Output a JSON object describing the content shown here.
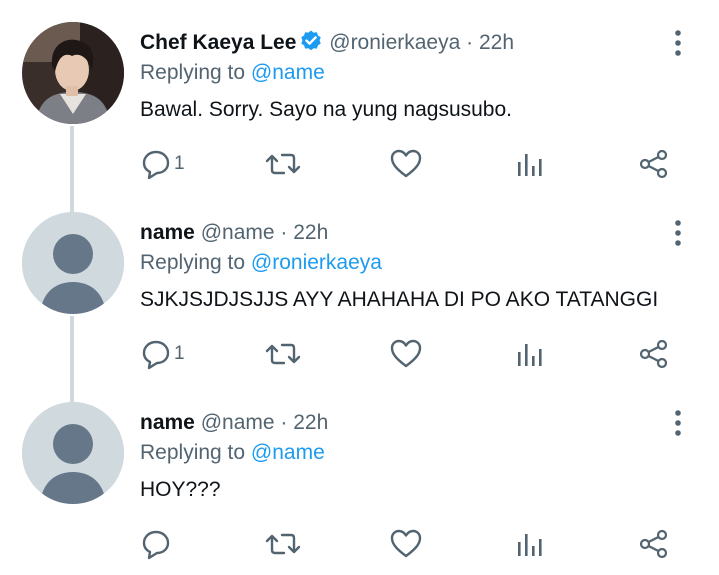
{
  "tweets": [
    {
      "display_name": "Chef Kaeya Lee",
      "verified": true,
      "handle": "@ronierkaeya",
      "separator": "·",
      "time": "22h",
      "replying_prefix": "Replying to",
      "replying_to": "@name",
      "text": "Bawal. Sorry. Sayo na yung nagsusubo.",
      "reply_count": "1",
      "avatar": "photo-avatar"
    },
    {
      "display_name": "name",
      "verified": false,
      "handle": "@name",
      "separator": "·",
      "time": "22h",
      "replying_prefix": "Replying to",
      "replying_to": "@ronierkaeya",
      "text": "SJKJSJDJSJJS AYY AHAHAHA DI PO AKO TATANGGI",
      "reply_count": "1",
      "avatar": "default-avatar"
    },
    {
      "display_name": "name",
      "verified": false,
      "handle": "@name",
      "separator": "·",
      "time": "22h",
      "replying_prefix": "Replying to",
      "replying_to": "@name",
      "text": "HOY???",
      "reply_count": "",
      "avatar": "default-avatar"
    }
  ],
  "icons": {
    "reply": "reply-icon",
    "retweet": "retweet-icon",
    "like": "heart-icon",
    "analytics": "analytics-icon",
    "share": "share-icon",
    "more": "more-vertical-icon",
    "verified": "verified-badge-icon"
  },
  "colors": {
    "accent": "#1d9bf0",
    "muted": "#536471",
    "thread_line": "#cfd9de"
  }
}
